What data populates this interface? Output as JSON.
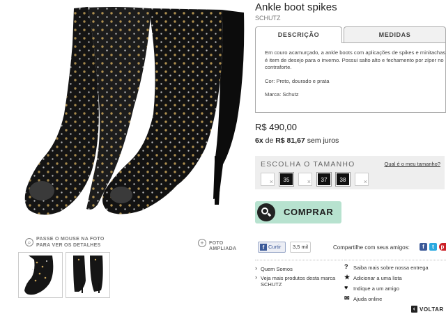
{
  "product": {
    "title": "Ankle boot spikes",
    "brand": "SCHUTZ"
  },
  "tabs": [
    {
      "label": "DESCRIÇÃO",
      "active": true
    },
    {
      "label": "MEDIDAS",
      "active": false
    }
  ],
  "description": {
    "paragraph": "Em couro acamurçado, a ankle boots com aplicações de spikes e minitachas é item de desejo para o inverno. Possui salto alto e fechamento por zíper no contraforte.",
    "color": "Cor: Preto, dourado e prata",
    "brand": "Marca: Schutz"
  },
  "pricing": {
    "price": "R$ 490,00",
    "installments_count": "6x",
    "installments_de": "de",
    "installment_value": "R$ 81,67",
    "installments_suffix": "sem juros"
  },
  "sizes": {
    "title": "ESCOLHA O TAMANHO",
    "help_link": "Qual é o meu tamanho?",
    "options": [
      {
        "label": "",
        "available": false
      },
      {
        "label": "35",
        "available": true
      },
      {
        "label": "",
        "available": false
      },
      {
        "label": "37",
        "available": true
      },
      {
        "label": "38",
        "available": true
      },
      {
        "label": "",
        "available": false
      }
    ]
  },
  "buy_button": {
    "label": "COMPRAR",
    "color": "#b7e2cf"
  },
  "image_hints": {
    "zoom_hint_line1": "PASSE O MOUSE NA FOTO",
    "zoom_hint_line2": "PARA VER OS DETALHES",
    "enlarge": "FOTO AMPLIADA"
  },
  "social": {
    "like_label": "Curtir",
    "like_count": "3,5 mil",
    "share_text": "Compartilhe com seus amigos:",
    "icons": [
      "facebook-icon",
      "twitter-icon",
      "pinterest-icon"
    ]
  },
  "links_left": [
    {
      "label": "Quem Somos"
    },
    {
      "label": "Veja mais produtos desta marca SCHUTZ"
    }
  ],
  "links_right": [
    {
      "icon": "question-icon",
      "label": "Saiba mais sobre nossa entrega"
    },
    {
      "icon": "star-icon",
      "label": "Adicionar a uma lista"
    },
    {
      "icon": "heart-icon",
      "label": "Indique a um amigo"
    },
    {
      "icon": "chat-icon",
      "label": "Ajuda online"
    }
  ],
  "back_link": {
    "label": "VOLTAR"
  }
}
